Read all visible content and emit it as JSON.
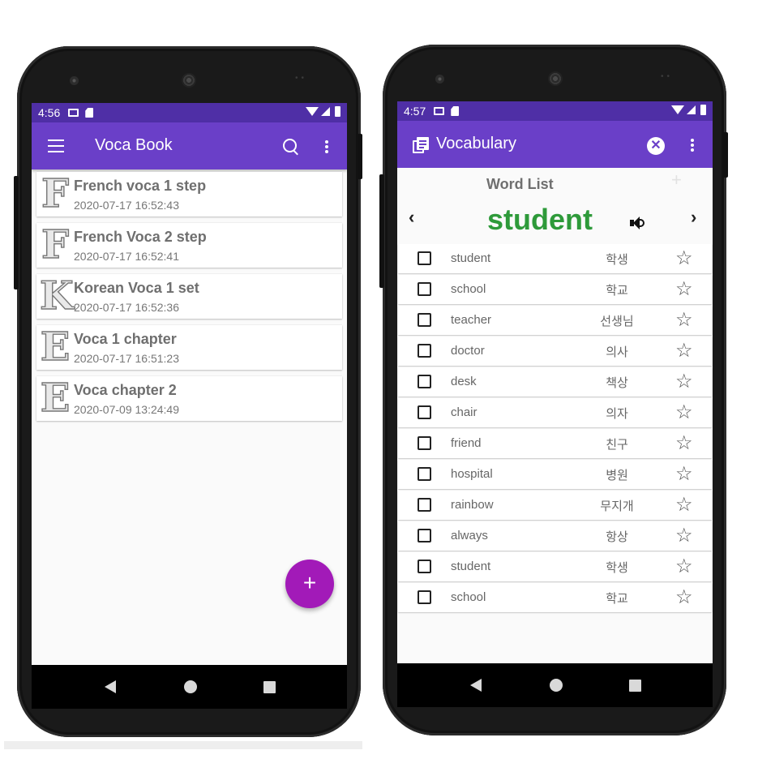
{
  "left_phone": {
    "status": {
      "time": "4:56"
    },
    "appbar": {
      "title": "Voca Book",
      "menu_icon": "menu-icon",
      "search_icon": "search-icon",
      "more_icon": "more-vert-icon"
    },
    "books": [
      {
        "letter": "F",
        "title": "French voca 1 step",
        "date": "2020-07-17 16:52:43"
      },
      {
        "letter": "F",
        "title": "French Voca 2 step",
        "date": "2020-07-17 16:52:41"
      },
      {
        "letter": "K",
        "title": "Korean Voca 1 set",
        "date": "2020-07-17 16:52:36"
      },
      {
        "letter": "E",
        "title": "Voca 1 chapter",
        "date": "2020-07-17 16:51:23"
      },
      {
        "letter": "E",
        "title": "Voca chapter 2",
        "date": "2020-07-09 13:24:49"
      }
    ],
    "fab": {
      "label": "+"
    }
  },
  "right_phone": {
    "status": {
      "time": "4:57"
    },
    "appbar": {
      "title": "Vocabulary",
      "book_icon": "library-books-icon",
      "close_icon": "cancel-icon",
      "more_icon": "more-vert-icon"
    },
    "word_list": {
      "header": "Word List",
      "add_label": "+",
      "prev_label": "‹",
      "next_label": "›",
      "current_word": "student",
      "speaker_icon": "volume-up-icon"
    },
    "words": [
      {
        "en": "student",
        "ko": "학생"
      },
      {
        "en": "school",
        "ko": "학교"
      },
      {
        "en": "teacher",
        "ko": "선생님"
      },
      {
        "en": "doctor",
        "ko": "의사"
      },
      {
        "en": "desk",
        "ko": "책상"
      },
      {
        "en": "chair",
        "ko": "의자"
      },
      {
        "en": "friend",
        "ko": "친구"
      },
      {
        "en": "hospital",
        "ko": "병원"
      },
      {
        "en": "rainbow",
        "ko": "무지개"
      },
      {
        "en": "always",
        "ko": "항상"
      },
      {
        "en": "student",
        "ko": "학생"
      },
      {
        "en": "school",
        "ko": "학교"
      }
    ]
  },
  "colors": {
    "status_bar": "#4f2fa6",
    "app_bar": "#6a3fc8",
    "fab": "#a21ab8",
    "current_word": "#2e9a3a"
  }
}
